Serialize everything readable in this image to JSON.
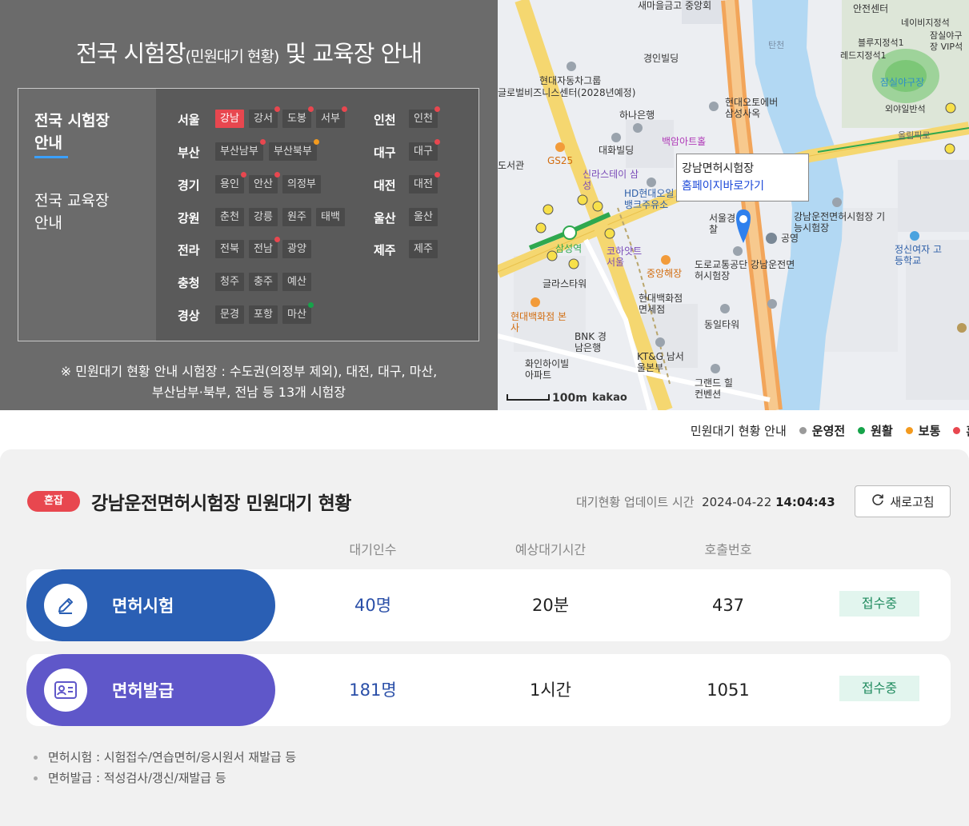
{
  "header": {
    "title_main": "전국 시험장",
    "title_sub": "(민원대기 현황)",
    "title_end": " 및 교육장 안내"
  },
  "nav": {
    "tabs": [
      {
        "label": "전국 시험장\n안내",
        "active": true
      },
      {
        "label": "전국 교육장\n안내",
        "active": false
      }
    ],
    "regions": [
      {
        "name": "서울",
        "centers": [
          {
            "label": "강남",
            "selected": true,
            "status": ""
          },
          {
            "label": "강서",
            "status": "red"
          },
          {
            "label": "도봉",
            "status": "red"
          },
          {
            "label": "서부",
            "status": "red"
          }
        ]
      },
      {
        "name": "부산",
        "centers": [
          {
            "label": "부산남부",
            "status": "red"
          },
          {
            "label": "부산북부",
            "status": "orange"
          }
        ]
      },
      {
        "name": "경기",
        "centers": [
          {
            "label": "용인",
            "status": "red"
          },
          {
            "label": "안산",
            "status": "red"
          },
          {
            "label": "의정부",
            "status": ""
          }
        ]
      },
      {
        "name": "강원",
        "centers": [
          {
            "label": "춘천",
            "status": ""
          },
          {
            "label": "강릉",
            "status": ""
          },
          {
            "label": "원주",
            "status": ""
          },
          {
            "label": "태백",
            "status": ""
          }
        ]
      },
      {
        "name": "전라",
        "centers": [
          {
            "label": "전북",
            "status": ""
          },
          {
            "label": "전남",
            "status": "red"
          },
          {
            "label": "광양",
            "status": ""
          }
        ]
      },
      {
        "name": "충청",
        "centers": [
          {
            "label": "청주",
            "status": ""
          },
          {
            "label": "충주",
            "status": ""
          },
          {
            "label": "예산",
            "status": ""
          }
        ]
      },
      {
        "name": "경상",
        "centers": [
          {
            "label": "문경",
            "status": ""
          },
          {
            "label": "포항",
            "status": ""
          },
          {
            "label": "마산",
            "status": "green"
          }
        ]
      },
      {
        "name": "인천",
        "centers": [
          {
            "label": "인천",
            "status": "red"
          }
        ]
      },
      {
        "name": "대구",
        "centers": [
          {
            "label": "대구",
            "status": "red"
          }
        ]
      },
      {
        "name": "대전",
        "centers": [
          {
            "label": "대전",
            "status": "red"
          }
        ]
      },
      {
        "name": "울산",
        "centers": [
          {
            "label": "울산",
            "status": ""
          }
        ]
      },
      {
        "name": "제주",
        "centers": [
          {
            "label": "제주",
            "status": ""
          }
        ]
      }
    ],
    "note_line1": "※ 민원대기 현황 안내 시험장 : 수도권(의정부 제외), 대전, 대구, 마산,",
    "note_line2": "부산남부·북부, 전남 등 13개 시험장"
  },
  "map": {
    "popup_title": "강남면허시험장",
    "popup_link": "홈페이지바로가기",
    "scale": "100m",
    "provider": "kakao",
    "labels": [
      "새마을금고 중앙회",
      "경인빌딩",
      "현대자동차그룹",
      "글로벌비즈니스센터(2028년예정)",
      "하나은행",
      "대화빌딩",
      "현대오토에버 삼성사옥",
      "백암아트홀",
      "GS25",
      "신라스테이 삼성",
      "HD현대오일뱅크주유소",
      "서울경찰",
      "강남운전면허시험장 기능시험장",
      "공영",
      "정신여자 고등학교",
      "삼성역",
      "코하얏트 서울",
      "중앙해장",
      "도로교통공단 강남운전면허시험장",
      "글라스타워",
      "현대백화점 면세점",
      "현대백화점 본사",
      "BNK 경남은행",
      "동일타워",
      "KT&G 남서울본부",
      "화인하이빌 아파트",
      "그랜드 힐컨벤션",
      "잠실야구장",
      "안전센터",
      "네이비지정석",
      "잠실야구장 VIP석",
      "블루지정석1",
      "레드지정석1",
      "외야일반석",
      "올림픽로",
      "탄천",
      "도서관"
    ]
  },
  "legend": {
    "title": "민원대기 현황 안내",
    "items": [
      {
        "label": "운영전",
        "color": "#9a9a9a"
      },
      {
        "label": "원활",
        "color": "#16a34a"
      },
      {
        "label": "보통",
        "color": "#f39a1e"
      },
      {
        "label": "혼잡",
        "color": "#e8474f"
      }
    ]
  },
  "center": {
    "status_badge": "혼잡",
    "title": "강남운전면허시험장 민원대기 현황",
    "update_label": "대기현황 업데이트 시간",
    "update_date": "2024-04-22",
    "update_time": "14:04:43",
    "refresh_label": "새로고침",
    "columns": [
      "대기인수",
      "예상대기시간",
      "호출번호"
    ],
    "services": [
      {
        "name": "면허시험",
        "waiting": "40명",
        "est_time": "20분",
        "call_no": "437",
        "state": "접수중",
        "color": "#2a5fb4",
        "icon": "pencil-icon"
      },
      {
        "name": "면허발급",
        "waiting": "181명",
        "est_time": "1시간",
        "call_no": "1051",
        "state": "접수중",
        "color": "#5f57c9",
        "icon": "id-card-icon"
      }
    ],
    "notes": [
      "면허시험 : 시험접수/연습면허/응시원서 재발급 등",
      "면허발급 : 적성검사/갱신/재발급 등"
    ]
  }
}
